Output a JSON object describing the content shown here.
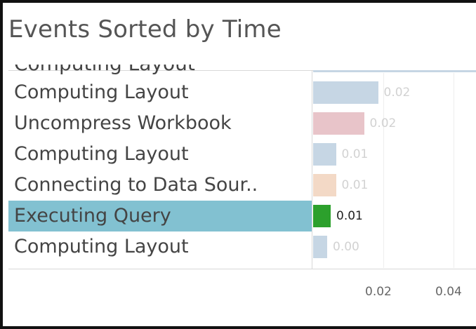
{
  "title": "Events Sorted by Time",
  "chart_data": {
    "type": "bar",
    "orientation": "horizontal",
    "title": "Events Sorted by Time",
    "categories": [
      "Computing Layout",
      "Uncompress Workbook",
      "Computing Layout",
      "Connecting to Data Sour..",
      "Executing Query",
      "Computing Layout"
    ],
    "values": [
      0.0185,
      0.0145,
      0.0065,
      0.0065,
      0.005,
      0.004
    ],
    "value_labels": [
      "0.02",
      "0.02",
      "0.01",
      "0.01",
      "0.01",
      "0.00"
    ],
    "bar_colors": [
      "#c6d6e4",
      "#e8c4c9",
      "#c6d6e4",
      "#f3d9c6",
      "#2ca02c",
      "#c6d6e4"
    ],
    "highlighted_index": 4,
    "xlim": [
      0,
      0.045
    ],
    "x_ticks": [
      "0.02",
      "0.04"
    ],
    "x_tick_values": [
      0.02,
      0.04
    ],
    "grid": true,
    "xlabel": "",
    "ylabel": ""
  },
  "colors": {
    "highlight_row": "#82c1d1",
    "default_bar": "#c6d6e4"
  }
}
